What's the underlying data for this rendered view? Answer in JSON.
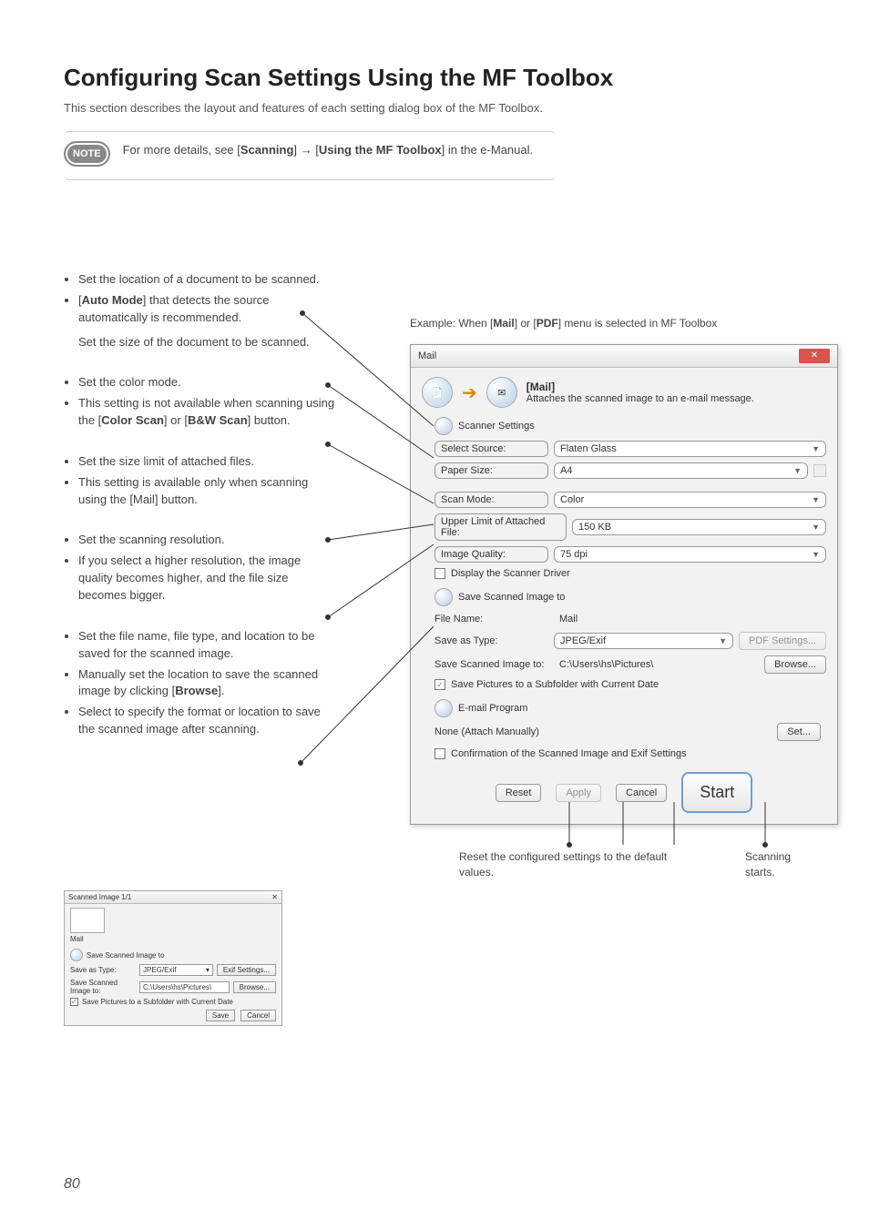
{
  "page": {
    "title": "Configuring Scan Settings Using the MF Toolbox",
    "intro": "This section describes the layout and features of each setting dialog box of the MF Toolbox.",
    "page_number": "80"
  },
  "note": {
    "badge": "NOTE",
    "text_prefix": "For more details, see [",
    "bold1": "Scanning",
    "mid": "] → [",
    "bold2": "Using the MF Toolbox",
    "suffix": "] in the e-Manual."
  },
  "callouts": {
    "g1a": "Set the location of a document to be scanned.",
    "g1b_pre": "[",
    "g1b_bold": "Auto Mode",
    "g1b_post": "] that detects the source automatically is recommended.",
    "g1c": "Set the size of the document to be scanned.",
    "g2a": "Set the color mode.",
    "g2b_pre": "This setting is not available when scanning using the [",
    "g2b_bold1": "Color Scan",
    "g2b_mid": "] or [",
    "g2b_bold2": "B&W Scan",
    "g2b_post": "] button.",
    "g3a": "Set the size limit of attached files.",
    "g3b": "This setting is available only when scanning using the [Mail] button.",
    "g4a": "Set the scanning resolution.",
    "g4b": "If you select a higher resolution, the image quality becomes higher, and the file size becomes bigger.",
    "g5a": "Set the file name, file type, and location to be saved for the scanned image.",
    "g5b_pre": "Manually set the location to save the scanned image by clicking [",
    "g5b_bold": "Browse",
    "g5b_post": "].",
    "g5c": "Select to specify the format or location to save the scanned image after scanning."
  },
  "example_caption_pre": "Example: When [",
  "example_caption_b1": "Mail",
  "example_caption_mid": "] or [",
  "example_caption_b2": "PDF",
  "example_caption_post": "] menu is selected in MF Toolbox",
  "dialog": {
    "title": "Mail",
    "header_bold": "[Mail]",
    "header_desc": "Attaches the scanned image to an e-mail message.",
    "section_scanner": "Scanner Settings",
    "select_source_lbl": "Select Source:",
    "select_source_val": "Flaten Glass",
    "paper_size_lbl": "Paper Size:",
    "paper_size_val": "A4",
    "scan_mode_lbl": "Scan Mode:",
    "scan_mode_val": "Color",
    "upper_limit_lbl": "Upper Limit of Attached File:",
    "upper_limit_val": "150 KB",
    "image_quality_lbl": "Image Quality:",
    "image_quality_val": "75 dpi",
    "display_driver": "Display the Scanner Driver",
    "section_save": "Save Scanned Image to",
    "file_name_lbl": "File Name:",
    "file_name_val": "Mail",
    "save_type_lbl": "Save as Type:",
    "save_type_val": "JPEG/Exif",
    "pdf_settings_btn": "PDF Settings...",
    "save_to_lbl": "Save Scanned Image to:",
    "save_to_val": "C:\\Users\\hs\\Pictures\\",
    "browse_btn": "Browse...",
    "save_subfolder": "Save Pictures to a Subfolder with Current Date",
    "section_email": "E-mail Program",
    "none_attach": "None (Attach Manually)",
    "set_btn": "Set...",
    "confirm_exif": "Confirmation of the Scanned Image and Exif Settings",
    "reset_btn": "Reset",
    "apply_btn": "Apply",
    "cancel_btn": "Cancel",
    "start_btn": "Start"
  },
  "below": {
    "reset_text": "Reset the configured settings to the default values.",
    "start_text": "Scanning starts."
  },
  "small_dialog": {
    "title": "Scanned Image 1/1",
    "thumb_label": "Mail",
    "section": "Save Scanned Image to",
    "save_type_lbl": "Save as Type:",
    "save_type_val": "JPEG/Exif",
    "exif_btn": "Exif Settings...",
    "save_to_lbl": "Save Scanned Image to:",
    "save_to_val": "C:\\Users\\hs\\Pictures\\",
    "browse_btn": "Browse...",
    "subfolder": "Save Pictures to a Subfolder with Current Date",
    "save_btn": "Save",
    "cancel_btn": "Cancel"
  }
}
